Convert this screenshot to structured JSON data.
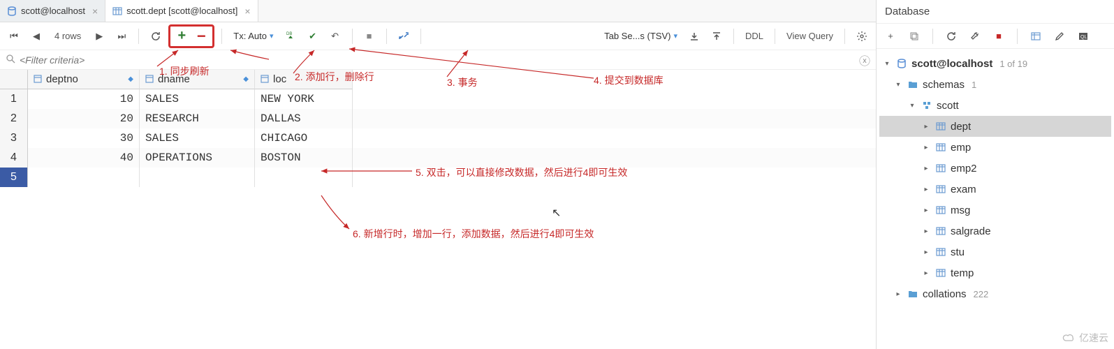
{
  "tabs": [
    {
      "label": "scott@localhost",
      "active": false
    },
    {
      "label": "scott.dept [scott@localhost]",
      "active": true
    }
  ],
  "toolbar": {
    "rows_label": "4 rows",
    "tx_label": "Tx: Auto",
    "tab_sep_label": "Tab Se...s (TSV)",
    "ddl_label": "DDL",
    "view_query_label": "View Query"
  },
  "filter": {
    "placeholder": "<Filter criteria>"
  },
  "columns": [
    "deptno",
    "dname",
    "loc"
  ],
  "rows": [
    {
      "n": "1",
      "deptno": "10",
      "dname": "SALES",
      "loc": "NEW YORK",
      "new": false
    },
    {
      "n": "2",
      "deptno": "20",
      "dname": "RESEARCH",
      "loc": "DALLAS",
      "new": false
    },
    {
      "n": "3",
      "deptno": "30",
      "dname": "SALES",
      "loc": "CHICAGO",
      "new": false
    },
    {
      "n": "4",
      "deptno": "40",
      "dname": "OPERATIONS",
      "loc": "BOSTON",
      "new": false
    },
    {
      "n": "5",
      "deptno": "<null>",
      "dname": "<null>",
      "loc": "<null>",
      "new": true
    }
  ],
  "annotations": {
    "a1": "1. 同步刷新",
    "a2": "2. 添加行，删除行",
    "a3": "3. 事务",
    "a4": "4. 提交到数据库",
    "a5": "5.  双击，可以直接修改数据，然后进行4即可生效",
    "a6": "6.  新增行时，增加一行，添加数据，然后进行4即可生效"
  },
  "database": {
    "title": "Database",
    "root": {
      "label": "scott@localhost",
      "count": "1 of 19"
    },
    "schemas": {
      "label": "schemas",
      "count": "1"
    },
    "schema": {
      "label": "scott"
    },
    "tables": [
      "dept",
      "emp",
      "emp2",
      "exam",
      "msg",
      "salgrade",
      "stu",
      "temp"
    ],
    "selected_table": "dept",
    "collations": {
      "label": "collations",
      "count": "222"
    }
  },
  "watermark": "亿速云"
}
